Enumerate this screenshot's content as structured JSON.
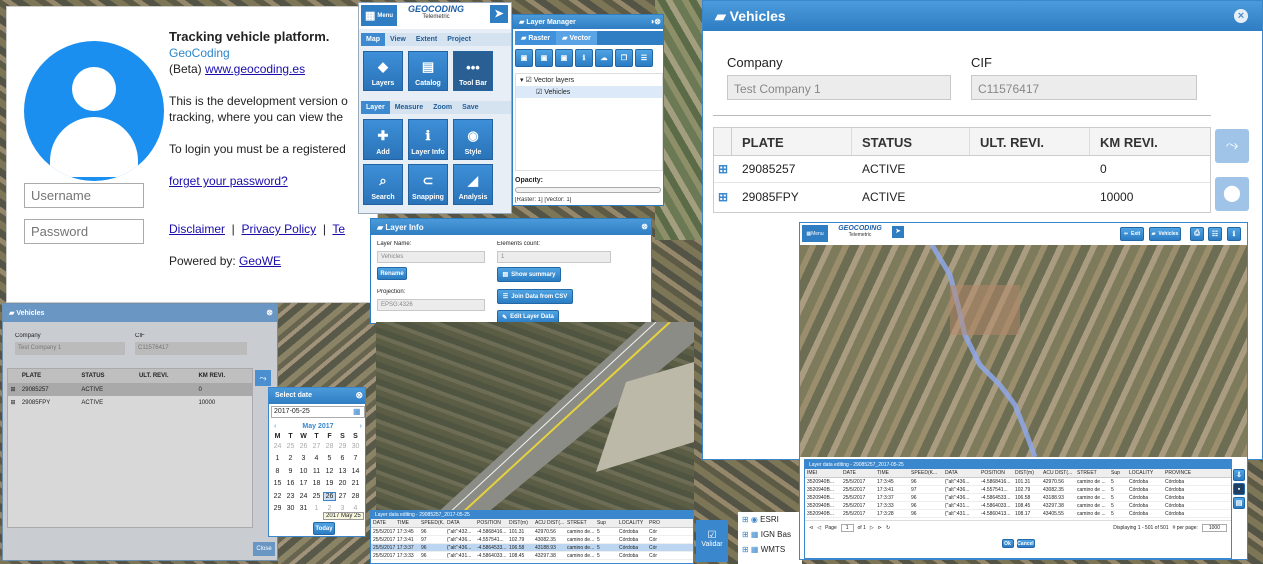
{
  "login": {
    "title": "Tracking vehicle platform.",
    "brand": "GeoCoding",
    "beta_prefix": "(Beta) ",
    "site_link": "www.geocoding.es",
    "dev_text_1": "This is the development version o",
    "dev_text_2": "tracking, where you can view the",
    "login_text": "To login you must be a registered",
    "forget_link": "forget your password?",
    "disclaimer": "Disclaimer",
    "privacy": "Privacy Policy",
    "terms": "Te",
    "powered_label": "Powered by: ",
    "powered_link": "GeoWE",
    "username_placeholder": "Username",
    "password_placeholder": "Password"
  },
  "toolbar": {
    "menu": "Menu",
    "logo_main": "GEOCODING",
    "logo_sub": "Telemetric",
    "tabs1": [
      "Map",
      "View",
      "Extent",
      "Project"
    ],
    "tiles1": [
      {
        "label": "Layers",
        "icon": "layers-icon",
        "glyph": "◆"
      },
      {
        "label": "Catalog",
        "icon": "catalog-icon",
        "glyph": "▤"
      },
      {
        "label": "Tool Bar",
        "icon": "toolbar-icon",
        "glyph": "•••"
      }
    ],
    "tabs2": [
      "Layer",
      "Measure",
      "Zoom",
      "Save"
    ],
    "tiles2": [
      {
        "label": "Add",
        "icon": "add-icon",
        "glyph": "✚"
      },
      {
        "label": "Layer Info",
        "icon": "info-icon",
        "glyph": "ℹ"
      },
      {
        "label": "Style",
        "icon": "style-icon",
        "glyph": "◉"
      },
      {
        "label": "Search",
        "icon": "binoculars-icon",
        "glyph": "⌕"
      },
      {
        "label": "Snapping",
        "icon": "magnet-icon",
        "glyph": "⊂"
      },
      {
        "label": "Analysis",
        "icon": "analysis-icon",
        "glyph": "◢"
      }
    ]
  },
  "layer_manager": {
    "title": "Layer Manager",
    "tab_raster": "Raster",
    "tab_vector": "Vector",
    "tree_root": "Vector layers",
    "tree_child": "Vehicles",
    "opacity": "Opacity:",
    "status": "[Raster: 1] [Vector: 1]"
  },
  "layer_info": {
    "title": "Layer Info",
    "name_label": "Layer Name:",
    "name_value": "Vehicles",
    "count_label": "Elements count:",
    "count_value": "1",
    "rename": "Rename",
    "show_summary": "Show summary",
    "projection_label": "Projection:",
    "projection_value": "EPSG:4326",
    "join_csv": "Join Data from CSV",
    "edit_data": "Edit Layer Data"
  },
  "vehicles_big": {
    "title": "Vehicles",
    "company_label": "Company",
    "company_value": "Test Company 1",
    "cif_label": "CIF",
    "cif_value": "C11576417",
    "headers": [
      "PLATE",
      "STATUS",
      "ULT. REVI.",
      "KM REVI."
    ],
    "rows": [
      {
        "plate": "29085257",
        "status": "ACTIVE",
        "ult": "",
        "km": "0"
      },
      {
        "plate": "29085FPY",
        "status": "ACTIVE",
        "ult": "",
        "km": "10000"
      }
    ],
    "layers_list": [
      "ESRI",
      "IGN Bas",
      "WMTS"
    ]
  },
  "vehicles_small": {
    "title": "Vehicles",
    "company_label": "Company",
    "company_value": "Test Company 1",
    "cif_label": "CIF",
    "cif_value": "C11576417",
    "headers": [
      "PLATE",
      "STATUS",
      "ULT. REVI.",
      "KM REVI."
    ],
    "rows": [
      {
        "plate": "29085257",
        "status": "ACTIVE",
        "ult": "",
        "km": "0"
      },
      {
        "plate": "29085FPY",
        "status": "ACTIVE",
        "ult": "",
        "km": "10000"
      }
    ],
    "close": "Close"
  },
  "datepicker": {
    "title": "Select date",
    "value": "2017-05-25",
    "month": "May 2017",
    "weekdays": [
      "M",
      "T",
      "W",
      "T",
      "F",
      "S",
      "S"
    ],
    "days": [
      "24",
      "25",
      "26",
      "27",
      "28",
      "29",
      "30",
      "1",
      "2",
      "3",
      "4",
      "5",
      "6",
      "7",
      "8",
      "9",
      "10",
      "11",
      "12",
      "13",
      "14",
      "15",
      "16",
      "17",
      "18",
      "19",
      "20",
      "21",
      "22",
      "23",
      "24",
      "25",
      "26",
      "27",
      "28",
      "29",
      "30",
      "31",
      "1",
      "2",
      "3",
      "4"
    ],
    "selected": "25",
    "tooltip": "2017 May 25",
    "today": "Today"
  },
  "validar": "Validar",
  "inner_app": {
    "logo_main": "GEOCODING",
    "logo_sub": "Telemetric",
    "menu": "Menu",
    "btn_exit": "Exit",
    "btn_vehicles": "Vehicles"
  },
  "data_grid_right": {
    "title": "Layer data editing - 29085257_2017-05-25",
    "headers": [
      "IMEI",
      "DATE",
      "TIME",
      "SPEED(K...",
      "DATA",
      "POSITION",
      "DIST(m)",
      "ACU DIST(...",
      "STREET",
      "Sup",
      "LOCALITY",
      "PROVINCE"
    ],
    "rows": [
      [
        "3520940B...",
        "25/5/2017",
        "17:3:45",
        "96",
        "{\"alt\":436...",
        "-4.5868416...",
        "101.31",
        "42970.56",
        "camino de ...",
        "5",
        "Córdoba",
        "Córdoba"
      ],
      [
        "3520940B...",
        "25/5/2017",
        "17:3:41",
        "97",
        "{\"alt\":436...",
        "-4.557541...",
        "102.79",
        "43082.35",
        "camino de ...",
        "5",
        "Córdoba",
        "Córdoba"
      ],
      [
        "3520940B...",
        "25/5/2017",
        "17:3:37",
        "96",
        "{\"alt\":436...",
        "-4.5864533...",
        "106.58",
        "43188.93",
        "camino de ...",
        "5",
        "Córdoba",
        "Córdoba"
      ],
      [
        "3520940B...",
        "25/5/2017",
        "17:3:33",
        "96",
        "{\"alt\":431...",
        "-4.5864033...",
        "108.45",
        "43297.38",
        "camino de ...",
        "5",
        "Córdoba",
        "Córdoba"
      ],
      [
        "3520940B...",
        "25/5/2017",
        "17:3:28",
        "96",
        "{\"alt\":431...",
        "-4.5860413...",
        "108.17",
        "43405.55",
        "camino de ...",
        "5",
        "Córdoba",
        "Córdoba"
      ]
    ],
    "page_label": "Page",
    "page": "1",
    "of": "of 1",
    "displaying": "Displaying 1 - 501 of 501",
    "perpage": "# per page:",
    "perpage_value": "1000",
    "ok": "Ok",
    "cancel": "Cancel"
  },
  "data_grid_center": {
    "title": "Layer data editing - 29085257_2017-05-25",
    "headers": [
      "DATE",
      "TIME",
      "SPEED(K...",
      "DATA",
      "POSITION",
      "DIST(m)",
      "ACU DIST(...",
      "STREET",
      "Sup",
      "LOCALITY",
      "PRO"
    ],
    "rows": [
      [
        "25/5/2017",
        "17:3:45",
        "96",
        "{\"alt\":432...",
        "-4.5868416...",
        "101.31",
        "42970.56",
        "camino de...",
        "5",
        "Córdoba",
        "Cór"
      ],
      [
        "25/5/2017",
        "17:3:41",
        "97",
        "{\"alt\":436...",
        "-4.557541...",
        "102.79",
        "43082.35",
        "camino de...",
        "5",
        "Córdoba",
        "Cór"
      ],
      [
        "25/5/2017",
        "17:3:37",
        "96",
        "{\"alt\":436...",
        "-4.5864533...",
        "106.58",
        "43188.93",
        "camino de...",
        "5",
        "Córdoba",
        "Cór"
      ],
      [
        "25/5/2017",
        "17:3:33",
        "96",
        "{\"alt\":431...",
        "-4.5864033...",
        "108.45",
        "43297.38",
        "camino de...",
        "5",
        "Córdoba",
        "Cór"
      ]
    ]
  }
}
